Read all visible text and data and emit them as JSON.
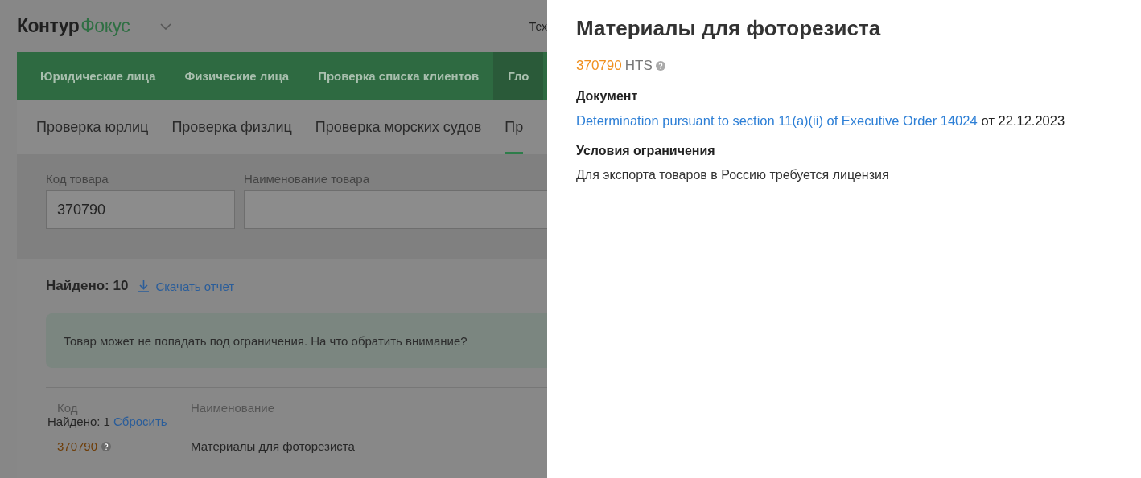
{
  "header": {
    "logo_left": "Контур",
    "logo_right": "Фокус",
    "menu_text": "Тех"
  },
  "main_nav": [
    {
      "label": "Юридические лица",
      "selected": false
    },
    {
      "label": "Физические лица",
      "selected": false
    },
    {
      "label": "Проверка списка клиентов",
      "selected": false
    },
    {
      "label": "Гло",
      "selected": true
    }
  ],
  "sub_nav": [
    {
      "label": "Проверка юрлиц",
      "selected": false
    },
    {
      "label": "Проверка физлиц",
      "selected": false
    },
    {
      "label": "Проверка морских судов",
      "selected": false
    },
    {
      "label": "Пр",
      "selected": true
    }
  ],
  "form": {
    "fields": [
      {
        "label": "Код товара",
        "value": "370790"
      },
      {
        "label": "Наименование товара"
      }
    ]
  },
  "results": {
    "found": "Найдено: 10",
    "download": "Скачать отчет",
    "notice": "Товар может не попадать под ограничения. На что обратить внимание?",
    "columns": [
      "Код",
      "Наименование"
    ],
    "filter_found": "Найдено: 1",
    "reset": "Сбросить",
    "rows": [
      {
        "code": "370790",
        "name": "Материалы для фоторезиста"
      }
    ]
  },
  "panel": {
    "title": "Материалы для фоторезиста",
    "code": "370790",
    "code_system": "HTS",
    "document_heading": "Документ",
    "document_link": "Determination pursuant to section 11(a)(ii) of Executive Order 14024",
    "document_date": "от 22.12.2023",
    "conditions_heading": "Условия ограничения",
    "conditions": "Для экспорта товаров в Россию требуется лицензия"
  }
}
